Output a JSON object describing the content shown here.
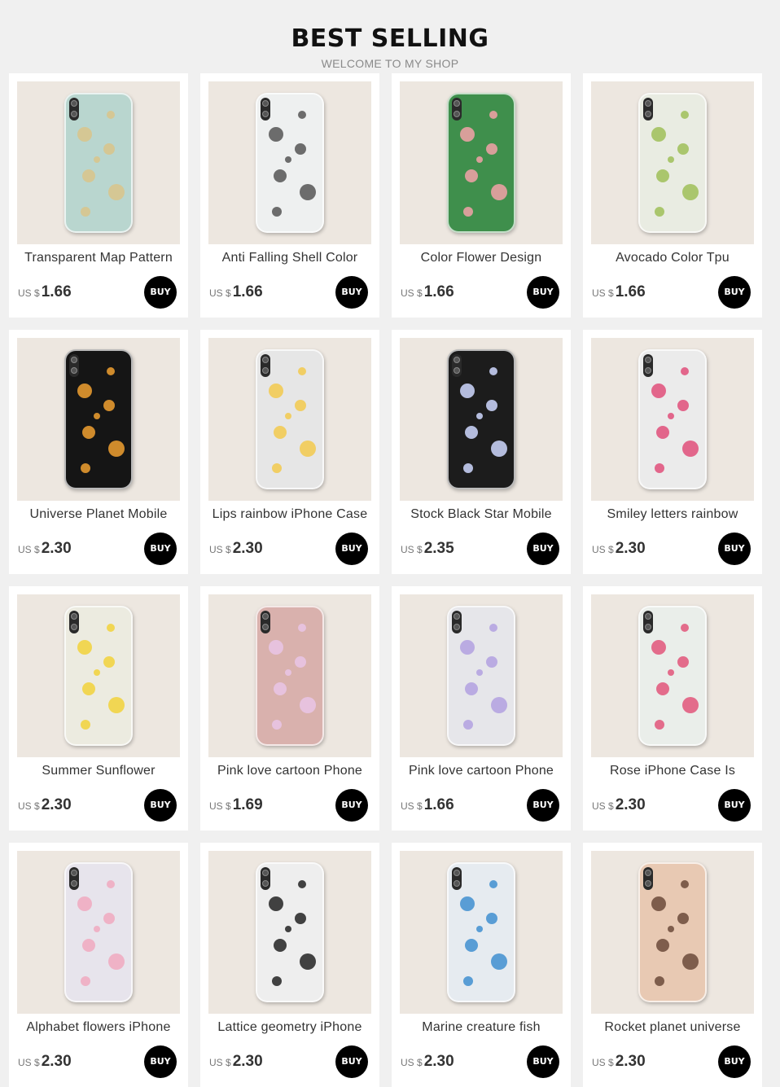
{
  "header": {
    "title": "BEST SELLING",
    "subtitle": "WELCOME TO MY SHOP"
  },
  "buy_label": "BUY",
  "currency": "US $",
  "products": [
    {
      "name": "Transparent Map Pattern",
      "price": "1.66",
      "case_color": "#b9d6cf",
      "pattern_color": "#d9c48a"
    },
    {
      "name": "Anti Falling Shell Color",
      "price": "1.66",
      "case_color": "#eef0f0",
      "pattern_color": "#555555"
    },
    {
      "name": "Color Flower Design",
      "price": "1.66",
      "case_color": "#3f8f4c",
      "pattern_color": "#f3a2a8"
    },
    {
      "name": "Avocado Color Tpu",
      "price": "1.66",
      "case_color": "#e9ece2",
      "pattern_color": "#9fbf58"
    },
    {
      "name": "Universe Planet Mobile",
      "price": "2.30",
      "case_color": "#151515",
      "pattern_color": "#f0a030"
    },
    {
      "name": "Lips rainbow iPhone Case",
      "price": "2.30",
      "case_color": "#e6e6e6",
      "pattern_color": "#f2c94c"
    },
    {
      "name": "Stock Black Star Mobile",
      "price": "2.35",
      "case_color": "#1c1c1c",
      "pattern_color": "#cfd8ff"
    },
    {
      "name": "Smiley letters rainbow",
      "price": "2.30",
      "case_color": "#ebebeb",
      "pattern_color": "#e04f7a"
    },
    {
      "name": "Summer Sunflower",
      "price": "2.30",
      "case_color": "#ecebe0",
      "pattern_color": "#f2d23a"
    },
    {
      "name": "Pink love cartoon Phone",
      "price": "1.69",
      "case_color": "#d9b1ad",
      "pattern_color": "#e9c5e6"
    },
    {
      "name": "Pink love cartoon Phone",
      "price": "1.66",
      "case_color": "#e6e6ea",
      "pattern_color": "#b1a0e0"
    },
    {
      "name": "Rose iPhone Case Is",
      "price": "2.30",
      "case_color": "#eaeeea",
      "pattern_color": "#e2557a"
    },
    {
      "name": "Alphabet flowers iPhone",
      "price": "2.30",
      "case_color": "#e7e4ec",
      "pattern_color": "#f0a9c0"
    },
    {
      "name": "Lattice geometry iPhone",
      "price": "2.30",
      "case_color": "#eeeeee",
      "pattern_color": "#222222"
    },
    {
      "name": "Marine creature fish",
      "price": "2.30",
      "case_color": "#e6ebf0",
      "pattern_color": "#3f8fd0"
    },
    {
      "name": "Rocket planet universe",
      "price": "2.30",
      "case_color": "#e8c9b3",
      "pattern_color": "#6b4a3a"
    }
  ]
}
